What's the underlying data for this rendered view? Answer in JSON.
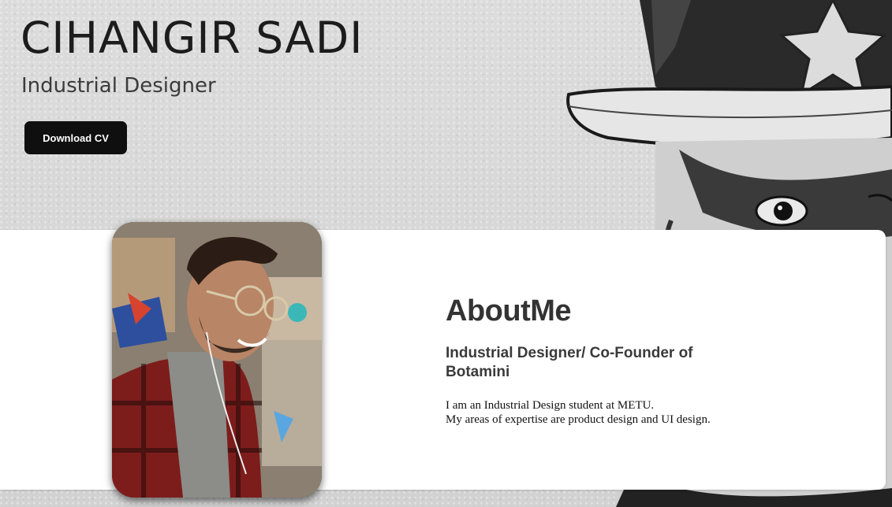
{
  "header": {
    "name": "CIHANGIR SADI",
    "title": "Industrial Designer",
    "download_label": "Download CV"
  },
  "about": {
    "heading": "AboutMe",
    "role": "Industrial Designer/ Co-Founder of Botamini",
    "lines": [
      "I am an Industrial Design student at METU.",
      "My areas of expertise are product design and UI design."
    ]
  },
  "colors": {
    "button_bg": "#0f0f0f",
    "card_bg": "#ffffff",
    "page_bg": "#d9d9d9"
  },
  "icons": {
    "illustration": "uncle-sam-engraving",
    "photo": "profile-photo"
  }
}
